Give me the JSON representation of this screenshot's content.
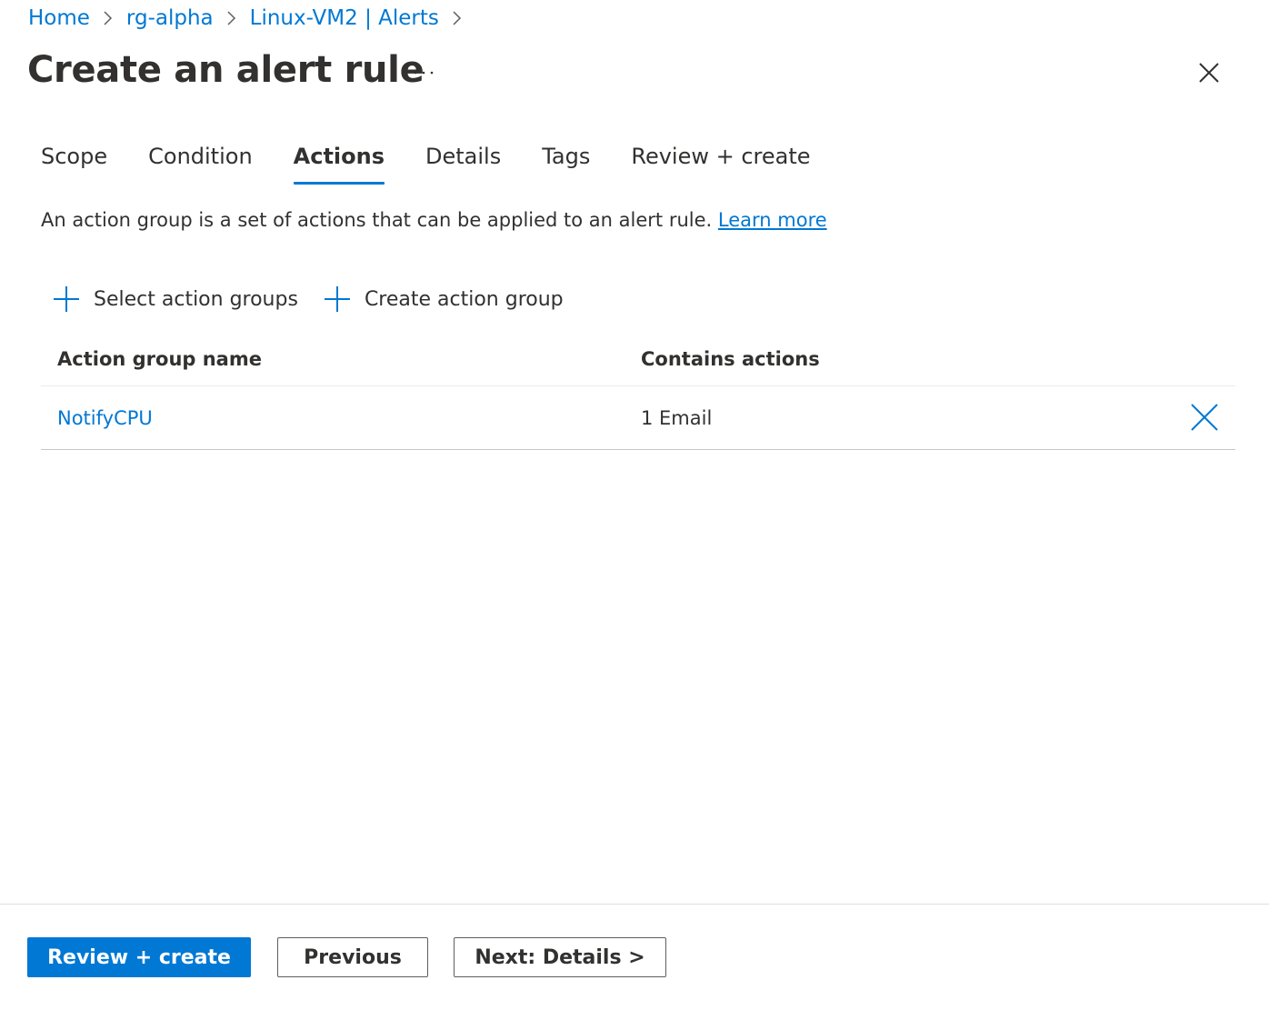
{
  "breadcrumb": [
    {
      "label": "Home"
    },
    {
      "label": "rg-alpha"
    },
    {
      "label": "Linux-VM2 | Alerts"
    }
  ],
  "page": {
    "title": "Create an alert rule",
    "more_label": "···"
  },
  "tabs": [
    {
      "label": "Scope",
      "active": false
    },
    {
      "label": "Condition",
      "active": false
    },
    {
      "label": "Actions",
      "active": true
    },
    {
      "label": "Details",
      "active": false
    },
    {
      "label": "Tags",
      "active": false
    },
    {
      "label": "Review + create",
      "active": false
    }
  ],
  "description": {
    "text": "An action group is a set of actions that can be applied to an alert rule.",
    "link": "Learn more"
  },
  "commands": {
    "select_label": "Select action groups",
    "create_label": "Create action group"
  },
  "table": {
    "columns": [
      "Action group name",
      "Contains actions"
    ],
    "rows": [
      {
        "name": "NotifyCPU",
        "actions": "1 Email"
      }
    ]
  },
  "footer": {
    "primary_label": "Review + create",
    "previous_label": "Previous",
    "next_label": "Next: Details >"
  },
  "colors": {
    "accent": "#0078d4",
    "text": "#323130",
    "border": "#605e5c"
  },
  "icons": {
    "breadcrumb_separator": "chevron-right-icon",
    "more": "ellipsis-icon",
    "close": "close-icon",
    "add": "plus-icon",
    "remove": "close-icon"
  }
}
